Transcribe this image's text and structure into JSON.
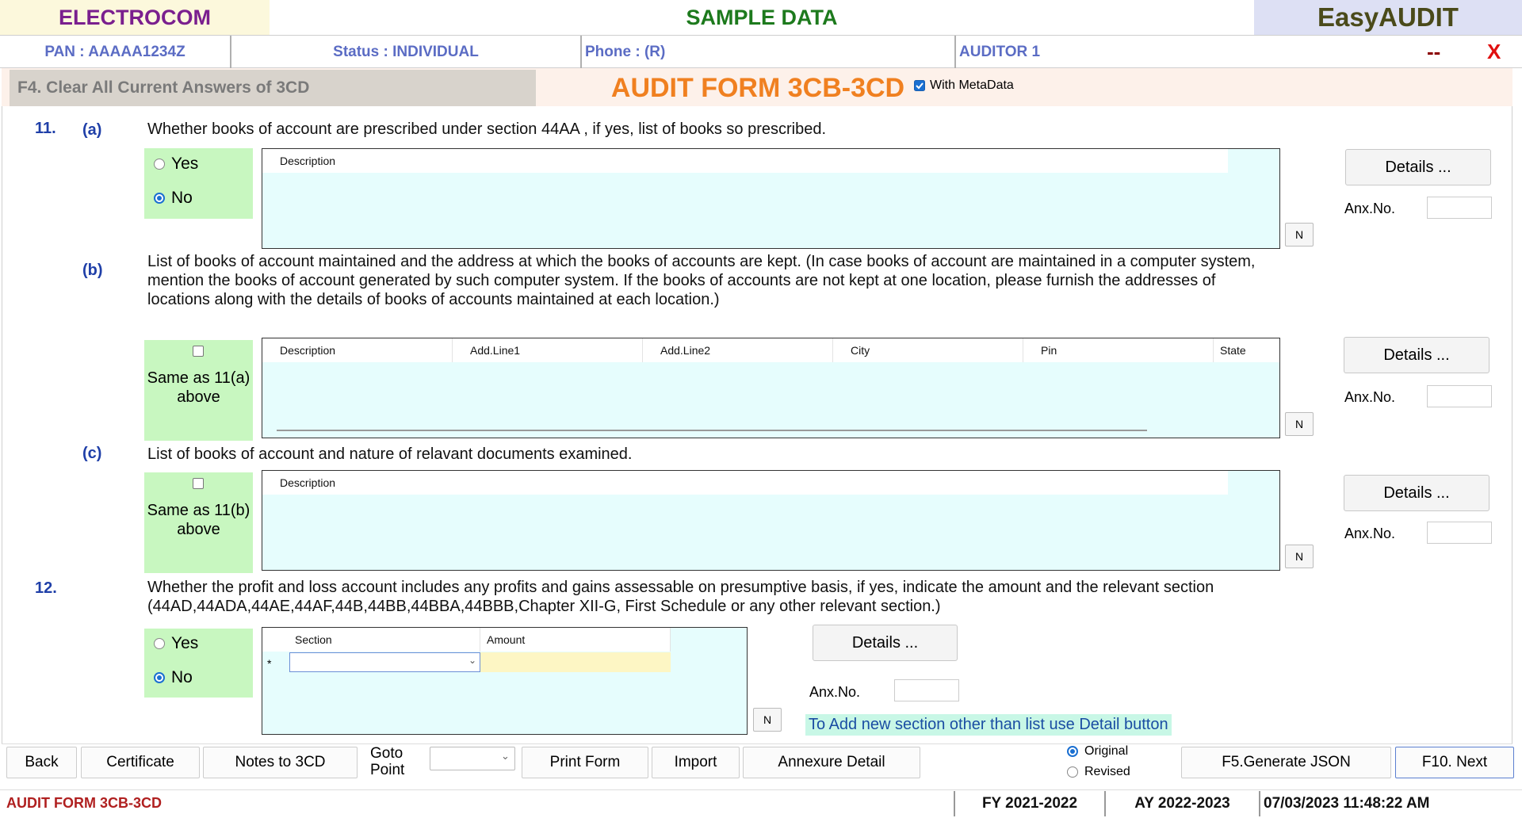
{
  "header": {
    "brand": "ELECTROCOM",
    "sample": "SAMPLE DATA",
    "product": "EasyAUDIT",
    "pan": "PAN  :  AAAAA1234Z",
    "status": "Status  :  INDIVIDUAL",
    "phone": "Phone  : (R)",
    "auditor": "AUDITOR 1",
    "minimize": "--",
    "close": "X"
  },
  "titlebar": {
    "clear_label": "F4. Clear All Current Answers of 3CD",
    "form_title": "AUDIT FORM 3CB-3CD",
    "metadata_label": "With MetaData",
    "metadata_checked": true
  },
  "q11": {
    "number": "11.",
    "a": {
      "label": "(a)",
      "text": "Whether books of account are prescribed under section 44AA , if  yes, list of books so prescribed.",
      "options": [
        "Yes",
        "No"
      ],
      "selected": "No",
      "columns": [
        "Description"
      ],
      "n_label": "N",
      "details_label": "Details ...",
      "anx_label": "Anx.No.",
      "anx_value": ""
    },
    "b": {
      "label": "(b)",
      "text": "List of books of account maintained and the address at which the books of accounts are kept. (In case books of account are maintained in a computer system, mention the books of account generated by such computer system. If the books of accounts are not kept at one location, please furnish the addresses of locations along with the details of books of accounts maintained at each location.)",
      "same_as": "Same as 11(a) above",
      "columns": [
        "Description",
        "Add.Line1",
        "Add.Line2",
        "City",
        "Pin",
        "State"
      ],
      "n_label": "N",
      "details_label": "Details ...",
      "anx_label": "Anx.No.",
      "anx_value": ""
    },
    "c": {
      "label": "(c)",
      "text": "List of books of account and nature of relavant documents examined.",
      "same_as": "Same as 11(b) above",
      "columns": [
        "Description"
      ],
      "n_label": "N",
      "details_label": "Details ...",
      "anx_label": "Anx.No.",
      "anx_value": ""
    }
  },
  "q12": {
    "number": "12.",
    "text": "Whether the profit and loss account includes any profits and gains assessable on presumptive basis, if yes, indicate the amount and the relevant section (44AD,44ADA,44AE,44AF,44B,44BB,44BBA,44BBB,Chapter XII-G, First Schedule or any other relevant section.)",
    "options": [
      "Yes",
      "No"
    ],
    "selected": "No",
    "columns": [
      "Section",
      "Amount"
    ],
    "new_row_marker": "*",
    "n_label": "N",
    "details_label": "Details ...",
    "anx_label": "Anx.No.",
    "anx_value": "",
    "hint": "To Add  new section other than list use Detail button"
  },
  "bottom": {
    "back": "Back",
    "certificate": "Certificate",
    "notes": "Notes to 3CD",
    "goto": "Goto Point",
    "goto_value": "",
    "print": "Print Form",
    "import": "Import",
    "annexure": "Annexure Detail",
    "original": "Original",
    "revised": "Revised",
    "return_type": "Original",
    "generate": "F5.Generate JSON",
    "next": "F10. Next"
  },
  "statusbar": {
    "form": "AUDIT FORM 3CB-3CD",
    "fy": "FY 2021-2022",
    "ay": "AY 2022-2023",
    "datetime": "07/03/2023 11:48:22 AM"
  },
  "colors": {
    "brand": "#7a1f8e",
    "sample": "#1d7a1d",
    "title": "#f08020",
    "question_num": "#1f3fa8",
    "green_panel": "#c8f7c0",
    "grid_bg": "#e6fdfd"
  }
}
